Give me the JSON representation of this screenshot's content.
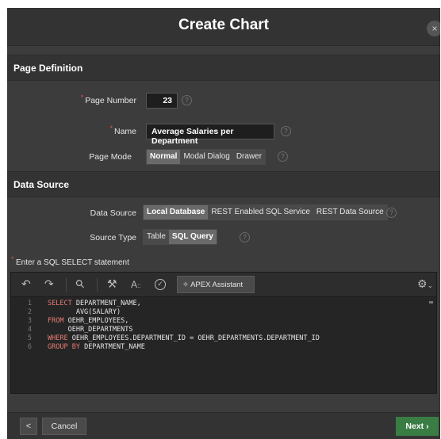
{
  "dialog": {
    "title": "Create Chart",
    "close_glyph": "×"
  },
  "page_definition": {
    "section_title": "Page Definition",
    "page_number_label": "Page Number",
    "page_number_value": "23",
    "name_label": "Name",
    "name_value": "Average Salaries per Department",
    "page_mode_label": "Page Mode",
    "page_mode_options": [
      "Normal",
      "Modal Dialog",
      "Drawer"
    ],
    "page_mode_selected": "Normal"
  },
  "data_source": {
    "section_title": "Data Source",
    "data_source_label": "Data Source",
    "data_source_options": [
      "Local Database",
      "REST Enabled SQL Service",
      "REST Data Source"
    ],
    "data_source_selected": "Local Database",
    "source_type_label": "Source Type",
    "source_type_options": [
      "Table",
      "SQL Query"
    ],
    "source_type_selected": "SQL Query",
    "sql_label": "Enter a SQL SELECT statement"
  },
  "editor": {
    "toolbar": {
      "undo_glyph": "↶",
      "redo_glyph": "↷",
      "search_glyph": "⚲",
      "wand_glyph": "⚒",
      "case_glyph": "A",
      "validate_glyph": "✓",
      "assistant_icon": "✧",
      "assistant_label": "APEX Assistant",
      "settings_glyph": "⚙"
    },
    "lines": [
      {
        "num": "1",
        "kw": "SELECT",
        "text": " DEPARTMENT_NAME,"
      },
      {
        "num": "2",
        "kw": "",
        "text": "       AVG(SALARY)"
      },
      {
        "num": "3",
        "kw": "FROM",
        "text": " OEHR_EMPLOYEES,"
      },
      {
        "num": "4",
        "kw": "",
        "text": "     OEHR_DEPARTMENTS"
      },
      {
        "num": "5",
        "kw": "WHERE",
        "text": " OEHR_EMPLOYEES.DEPARTMENT_ID = OEHR_DEPARTMENTS.DEPARTMENT_ID"
      },
      {
        "num": "6",
        "kw": "GROUP BY",
        "text": " DEPARTMENT_NAME"
      }
    ]
  },
  "footer": {
    "back_glyph": "<",
    "cancel_label": "Cancel",
    "next_label": "Next",
    "next_glyph": "›"
  }
}
